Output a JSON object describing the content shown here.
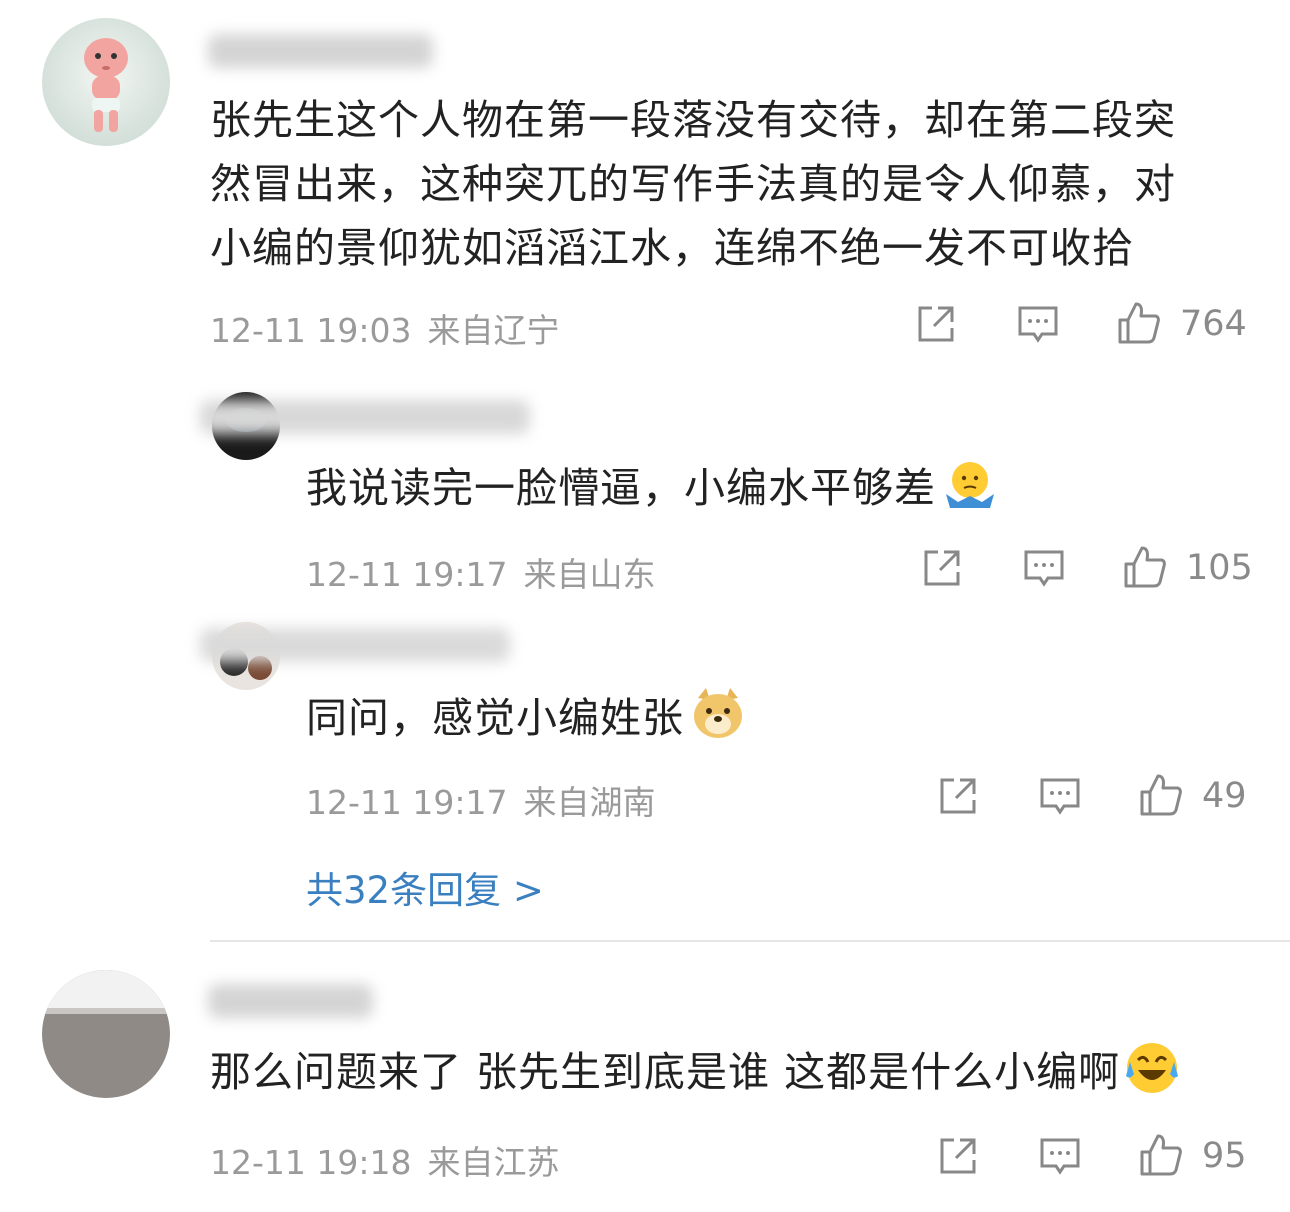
{
  "colors": {
    "text": "#222222",
    "meta": "#9a9a9a",
    "link": "#3a7fc0"
  },
  "comments": [
    {
      "text_lines": [
        "张先生这个人物在第一段落没有交待，却在第二段突",
        "然冒出来，这种突兀的写作手法真的是令人仰慕，对",
        "小编的景仰犹如滔滔江水，连绵不绝一发不可收拾"
      ],
      "time": "12-11 19:03",
      "location": "来自辽宁",
      "likes": "764",
      "avatar_icon": "baby-doll-avatar"
    },
    {
      "text": "我说读完一脸懵逼，小编水平够差",
      "emoji": "shrug-emoji",
      "time": "12-11 19:17",
      "location": "来自山东",
      "likes": "105"
    },
    {
      "text": "同问，感觉小编姓张",
      "emoji": "doge-emoji",
      "time": "12-11 19:17",
      "location": "来自湖南",
      "likes": "49"
    },
    {
      "text": "那么问题来了 张先生到底是谁 这都是什么小编啊",
      "emoji": "laugh-cry-emoji",
      "time": "12-11 19:18",
      "location": "来自江苏",
      "likes": "95"
    }
  ],
  "replies_link": "共32条回复 >"
}
